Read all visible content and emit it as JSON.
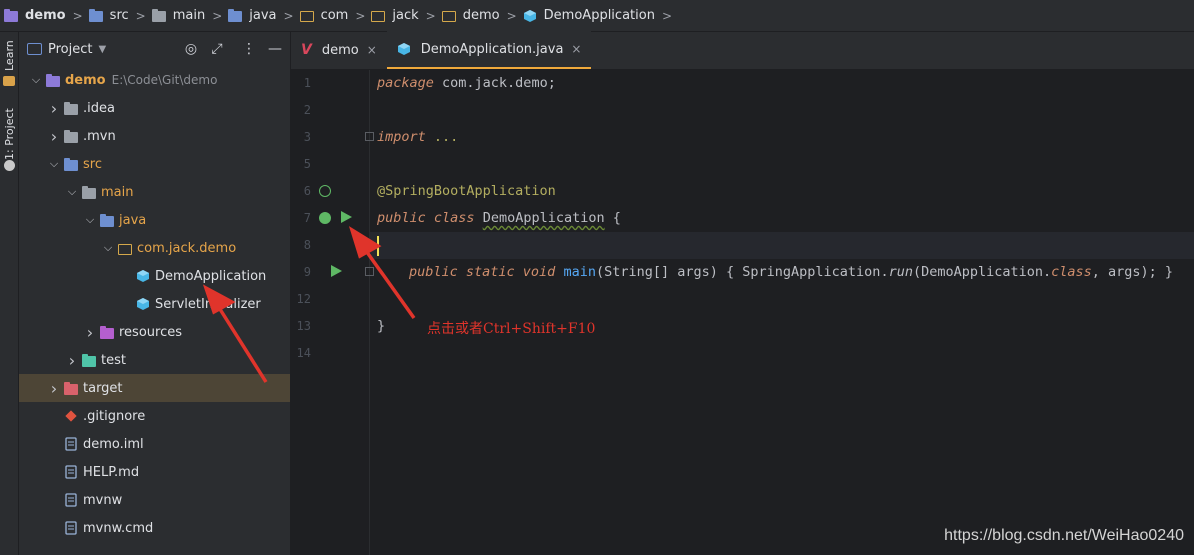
{
  "breadcrumb": [
    {
      "label": "demo",
      "icon": "project-folder-icon"
    },
    {
      "label": "src",
      "icon": "source-folder-icon"
    },
    {
      "label": "main",
      "icon": "folder-icon"
    },
    {
      "label": "java",
      "icon": "folder-icon"
    },
    {
      "label": "com",
      "icon": "package-icon"
    },
    {
      "label": "jack",
      "icon": "package-icon"
    },
    {
      "label": "demo",
      "icon": "package-icon"
    },
    {
      "label": "DemoApplication",
      "icon": "class-icon"
    }
  ],
  "left_strip": {
    "learn": "Learn",
    "project": "1: Project"
  },
  "project_panel": {
    "title": "Project",
    "tree": [
      {
        "label": "demo",
        "path": "E:\\Code\\Git\\demo",
        "arrow": "v",
        "icon": "project-folder-icon"
      },
      {
        "label": ".idea",
        "arrow": ">",
        "icon": "folder-icon"
      },
      {
        "label": ".mvn",
        "arrow": ">",
        "icon": "folder-icon"
      },
      {
        "label": "src",
        "arrow": "v",
        "icon": "source-folder-icon"
      },
      {
        "label": "main",
        "arrow": "v",
        "icon": "folder-icon"
      },
      {
        "label": "java",
        "arrow": "v",
        "icon": "source-root-icon"
      },
      {
        "label": "com.jack.demo",
        "arrow": "v",
        "icon": "package-icon"
      },
      {
        "label": "DemoApplication",
        "arrow": "",
        "icon": "spring-class-icon"
      },
      {
        "label": "ServletInitializer",
        "arrow": "",
        "icon": "spring-class-icon"
      },
      {
        "label": "resources",
        "arrow": ">",
        "icon": "resources-folder-icon"
      },
      {
        "label": "test",
        "arrow": ">",
        "icon": "test-folder-icon"
      },
      {
        "label": "target",
        "arrow": ">",
        "icon": "excluded-folder-icon"
      },
      {
        "label": ".gitignore",
        "arrow": "",
        "icon": "git-icon"
      },
      {
        "label": "demo.iml",
        "arrow": "",
        "icon": "iml-file-icon"
      },
      {
        "label": "HELP.md",
        "arrow": "",
        "icon": "markdown-file-icon"
      },
      {
        "label": "mvnw",
        "arrow": "",
        "icon": "script-file-icon"
      },
      {
        "label": "mvnw.cmd",
        "arrow": "",
        "icon": "cmd-file-icon"
      }
    ]
  },
  "tabs": [
    {
      "label": "demo",
      "icon": "maven-icon",
      "active": false
    },
    {
      "label": "DemoApplication.java",
      "icon": "class-icon",
      "active": true
    }
  ],
  "code": {
    "line_numbers": [
      "1",
      "2",
      "3",
      "5",
      "6",
      "7",
      "8",
      "9",
      "12",
      "13",
      "14"
    ],
    "l1_kw": "package",
    "l1_rest": " com.jack.demo;",
    "l3_kw": "import",
    "l3_rest": " ...",
    "l6": "@SpringBootApplication",
    "l7_kw": "public class",
    "l7_cls": "DemoApplication",
    "l7_rest": " {",
    "l9_kw": "public static void",
    "l9_fn": "main",
    "l9_a": "(String[] args) { SpringApplication.",
    "l9_run": "run",
    "l9_b": "(DemoApplication.",
    "l9_class": "class",
    "l9_c": ", args); }",
    "l13": "}"
  },
  "annotation_note": "点击或者Ctrl+Shift+F10",
  "watermark": "https://blog.csdn.net/WeiHao0240",
  "colors": {
    "accent": "#f0a93b",
    "run": "#5fb865",
    "arrow": "#e0342b"
  }
}
